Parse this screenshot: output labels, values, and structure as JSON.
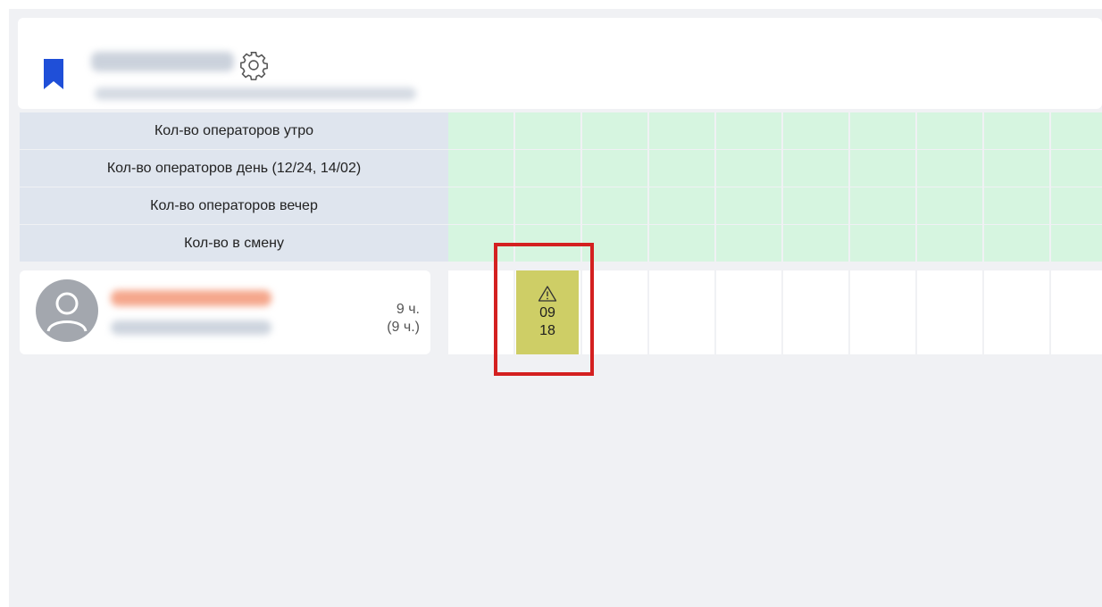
{
  "header": {
    "icons": [
      "bookmark-icon",
      "gear-icon"
    ],
    "accent": "#1f4fd8"
  },
  "rows": [
    {
      "label": "Кол-во операторов утро"
    },
    {
      "label": "Кол-во операторов день (12/24, 14/02)"
    },
    {
      "label": "Кол-во операторов вечер"
    },
    {
      "label": "Кол-во в смену"
    }
  ],
  "employee": {
    "hours": "9 ч.",
    "hours_total": "(9 ч.)",
    "icon": "user-avatar-icon"
  },
  "shift": {
    "start": "09",
    "end": "18",
    "icon": "warning-icon",
    "color": "#cece66"
  },
  "colors": {
    "summary_cell": "#d6f5e0",
    "label_bg": "#dfe5ee",
    "highlight": "#d42020"
  }
}
